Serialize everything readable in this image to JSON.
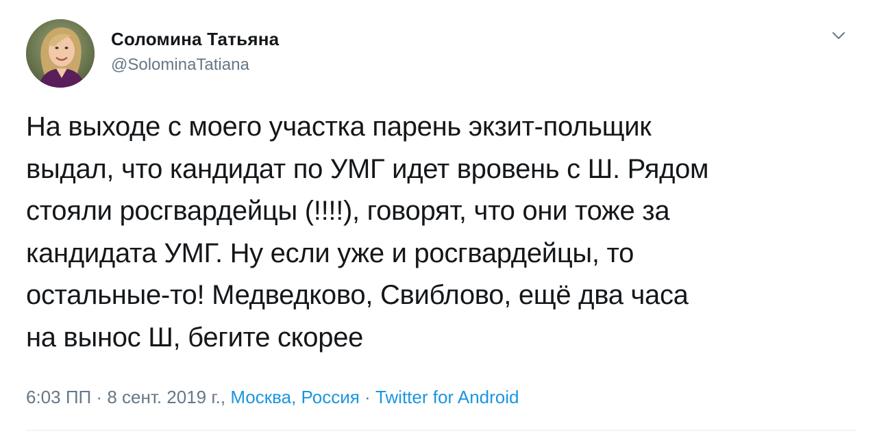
{
  "tweet": {
    "author": {
      "display_name": "Соломина Татьяна",
      "handle": "@SolominaTatiana"
    },
    "text": "На выходе с моего участка парень экзит-польщик\nвыдал, что кандидат по УМГ идет вровень с Ш. Рядом\nстояли росгвардейцы (!!!!), говорят, что они тоже за\nкандидата УМГ. Ну если уже и росгвардейцы, то\nостальные-то! Медведково, Свиблово, ещё два часа\nна вынос Ш, бегите скорее",
    "meta": {
      "time": "6:03 ПП",
      "separator": " · ",
      "date": "8 сент. 2019 г., ",
      "location": "Москва, Россия",
      "source": "Twitter for Android"
    },
    "icons": {
      "menu": "chevron-down-icon",
      "avatar": "avatar"
    },
    "colors": {
      "text": "#14171a",
      "secondary": "#657786",
      "link": "#1b95e0"
    }
  }
}
